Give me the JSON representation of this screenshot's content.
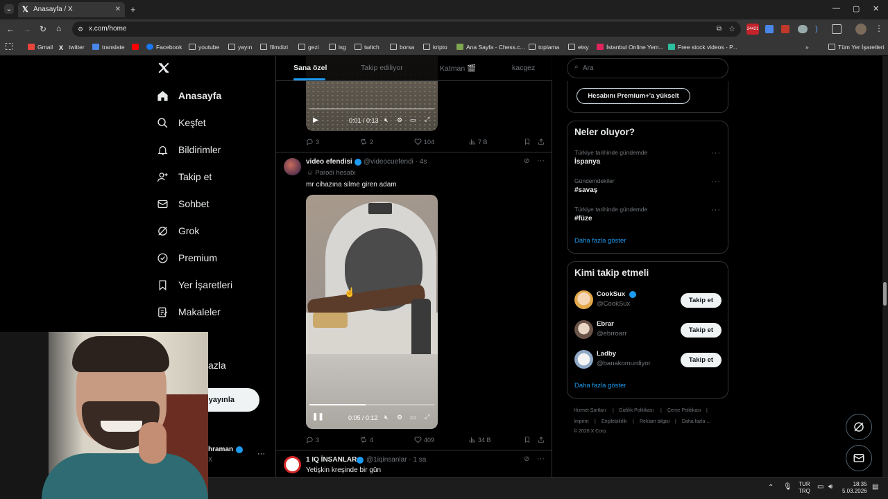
{
  "browser": {
    "tab_title": "Anasayfa / X",
    "url": "x.com/home",
    "bookmarks": [
      "Gmail",
      "twitter",
      "translate",
      "Facebook",
      "youtube",
      "yayın",
      "filmdizi",
      "gezi",
      "isg",
      "twitch",
      "borsa",
      "kripto",
      "Ana Sayfa - Chess.c...",
      "toplama",
      "etsy",
      "İstanbul Online Yem...",
      "Free stock videos - P..."
    ],
    "all_bookmarks": "Tüm Yer İşaretleri",
    "ext_badge": "24421"
  },
  "sidebar": {
    "items": [
      {
        "label": "Anasayfa",
        "icon": "home-icon"
      },
      {
        "label": "Keşfet",
        "icon": "search-icon"
      },
      {
        "label": "Bildirimler",
        "icon": "bell-icon"
      },
      {
        "label": "Takip et",
        "icon": "person-add-icon"
      },
      {
        "label": "Sohbet",
        "icon": "mail-icon"
      },
      {
        "label": "Grok",
        "icon": "grok-icon"
      },
      {
        "label": "Premium",
        "icon": "verified-icon"
      },
      {
        "label": "Yer İşaretleri",
        "icon": "bookmark-icon"
      },
      {
        "label": "Makaleler",
        "icon": "article-icon"
      }
    ],
    "more_partial": "azla",
    "post_partial": "yayınla",
    "profile_partial": "hraman",
    "profile_handle_partial": "X"
  },
  "feed": {
    "tabs": [
      "Sana özel",
      "Takip ediliyor",
      "Katman 🎬",
      "kacgez"
    ],
    "post1": {
      "video_time": "0:01 / 0:13",
      "replies": "3",
      "reposts": "2",
      "likes": "104",
      "views": "7 B"
    },
    "post2": {
      "name": "video efendisi",
      "handle": "@videocuefendi · 4s",
      "label": "Parodi hesabı",
      "text": "mr cihazına silme giren adam",
      "video_time": "0:05 / 0:12",
      "video_progress": 0.45,
      "replies": "3",
      "reposts": "4",
      "likes": "409",
      "views": "34 B"
    },
    "post3": {
      "name": "1 IQ İNSANLAR",
      "handle": "@1iqinsanlar · 1 sa",
      "text": "Yetişkin kreşinde bir gün"
    }
  },
  "right": {
    "search_placeholder": "Ara",
    "premium_button": "Hesabını Premium+'a yükselt",
    "trends_title": "Neler oluyor?",
    "trends": [
      {
        "category": "Türkiye tarihinde gündemde",
        "name": "İspanya"
      },
      {
        "category": "Gündemdekiler",
        "name": "#savaş"
      },
      {
        "category": "Türkiye tarihinde gündemde",
        "name": "#füze"
      }
    ],
    "show_more": "Daha fazla göster",
    "who_title": "Kimi takip etmeli",
    "who": [
      {
        "name": "CookSux",
        "handle": "@CookSux",
        "verified": true
      },
      {
        "name": "Ebrar",
        "handle": "@ebrroarr",
        "verified": false
      },
      {
        "name": "Ladby",
        "handle": "@banakomurdiyor",
        "verified": false
      }
    ],
    "follow_label": "Takip et",
    "who_more": "Daha fazla göster",
    "footer": [
      "Hizmet Şartları",
      "|",
      "Gizlilik Politikası",
      "|",
      "Çerez Politikası",
      "|",
      "İmprint",
      "|",
      "Erişilebilirlik",
      "|",
      "Reklam bilgisi",
      "|",
      "Daha fazla ..."
    ],
    "copyright": "© 2026 X Corp."
  },
  "taskbar": {
    "lang1": "TUR",
    "lang2": "TRQ",
    "time": "18:35",
    "date": "5.03.2026"
  },
  "colors": {
    "accent": "#1d9bf0",
    "background": "#000000",
    "border": "#2f3336",
    "muted": "#71767b"
  }
}
